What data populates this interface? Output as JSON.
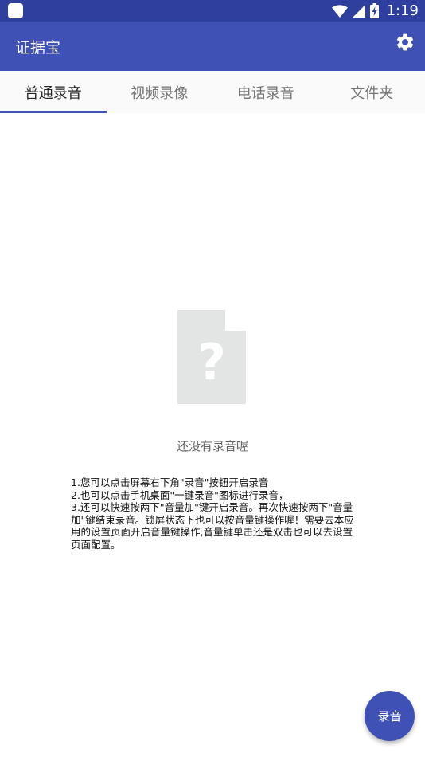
{
  "status_bar": {
    "time": "1:19",
    "icons": [
      "app-notification-icon",
      "wifi-icon",
      "cellular-signal-icon",
      "battery-charging-icon"
    ]
  },
  "app_bar": {
    "title": "证据宝",
    "settings_icon": "gear-icon"
  },
  "tabs": [
    {
      "label": "普通录音",
      "active": true
    },
    {
      "label": "视频录像",
      "active": false
    },
    {
      "label": "电话录音",
      "active": false
    },
    {
      "label": "文件夹",
      "active": false
    }
  ],
  "empty_state": {
    "icon": "unknown-file-icon",
    "message": "还没有录音喔",
    "instructions": [
      "1.您可以点击屏幕右下角\"录音\"按钮开启录音",
      "2.也可以点击手机桌面\"一键录音\"图标进行录音，",
      "3.还可以快速按两下\"音量加\"键开启录音。再次快速按两下\"音量加\"键结束录音。锁屏状态下也可以按音量键操作喔！需要去本应用的设置页面开启音量键操作,音量键单击还是双击也可以去设置页面配置。"
    ]
  },
  "fab": {
    "label": "录音"
  },
  "colors": {
    "primary": "#3f51b5",
    "primary_dark": "#2f3f9e",
    "tab_background": "#fafafa",
    "placeholder_icon": "#e3e5e5"
  }
}
